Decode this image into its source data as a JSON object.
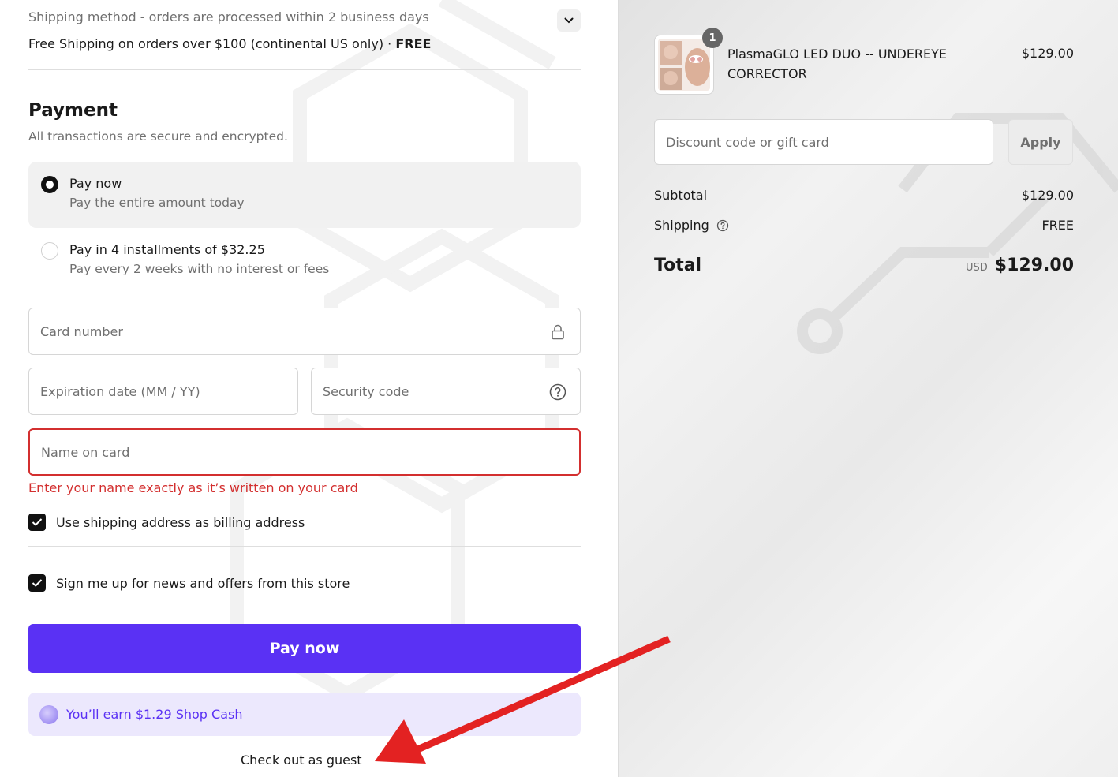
{
  "shipping": {
    "method_label": "Shipping method - orders are processed within 2 business days",
    "option_label": "Free Shipping on orders over $100 (continental US only)",
    "separator": "·",
    "option_price": "FREE"
  },
  "payment": {
    "title": "Payment",
    "subtitle": "All transactions are secure and encrypted.",
    "options": [
      {
        "title": "Pay now",
        "desc": "Pay the entire amount today",
        "selected": true
      },
      {
        "title": "Pay in 4 installments of $32.25",
        "desc": "Pay every 2 weeks with no interest or fees",
        "selected": false
      }
    ],
    "card_number_placeholder": "Card number",
    "expiry_placeholder": "Expiration date (MM / YY)",
    "cvv_placeholder": "Security code",
    "name_placeholder": "Name on card",
    "name_error": "Enter your name exactly as it’s written on your card",
    "billing_checkbox_label": "Use shipping address as billing address",
    "billing_checked": true,
    "newsletter_checkbox_label": "Sign me up for news and offers from this store",
    "newsletter_checked": true,
    "pay_button": "Pay now",
    "shop_cash": "You’ll earn $1.29 Shop Cash",
    "guest_link": "Check out as guest"
  },
  "summary": {
    "product": {
      "name": "PlasmaGLO LED DUO -- UNDEREYE CORRECTOR",
      "price": "$129.00",
      "quantity": "1"
    },
    "discount_placeholder": "Discount code or gift card",
    "apply_button": "Apply",
    "subtotal_label": "Subtotal",
    "subtotal_value": "$129.00",
    "shipping_label": "Shipping",
    "shipping_value": "FREE",
    "total_label": "Total",
    "currency": "USD",
    "total_value": "$129.00"
  },
  "colors": {
    "accent": "#5a31f4",
    "error": "#d32f2f",
    "annotation_arrow": "#e32222"
  }
}
